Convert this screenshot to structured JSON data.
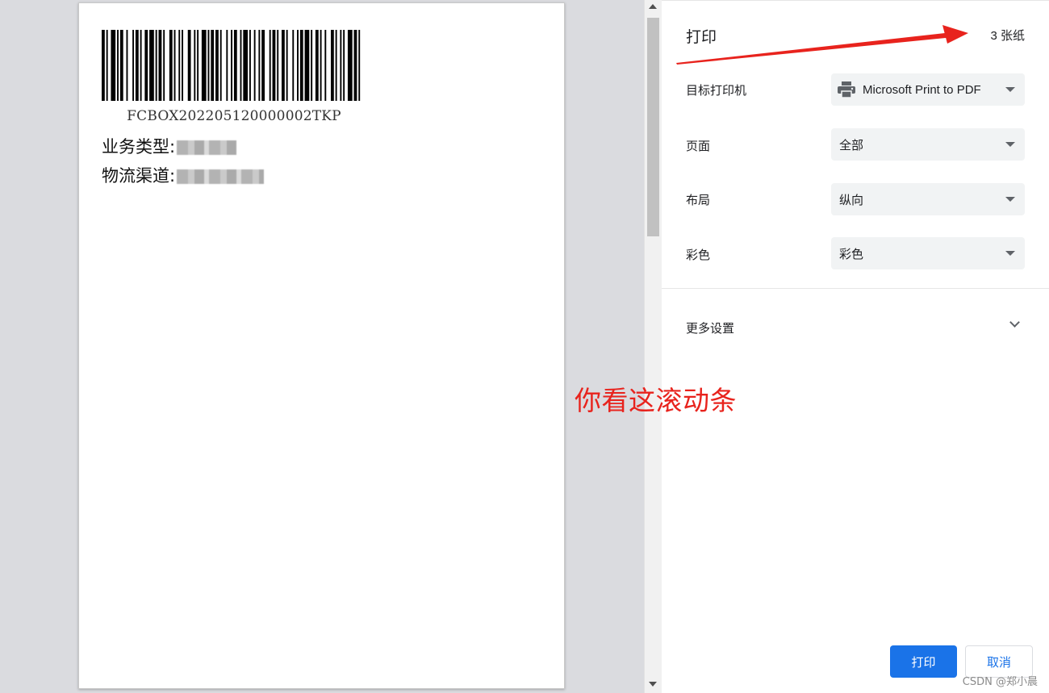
{
  "preview": {
    "barcode_text": "FCBOX202205120000002TKP",
    "fields": [
      {
        "label": "业务类型:"
      },
      {
        "label": "物流渠道:"
      }
    ]
  },
  "panel": {
    "title": "打印",
    "sheet_count": "3 张纸",
    "settings": {
      "printer": {
        "label": "目标打印机",
        "value": "Microsoft Print to PDF"
      },
      "pages": {
        "label": "页面",
        "value": "全部"
      },
      "layout": {
        "label": "布局",
        "value": "纵向"
      },
      "color": {
        "label": "彩色",
        "value": "彩色"
      }
    },
    "more_settings": "更多设置",
    "print_button": "打印",
    "cancel_button": "取消"
  },
  "annotation": {
    "text": "你看这滚动条",
    "color": "#e8231d"
  },
  "watermark": "CSDN @郑小晨",
  "colors": {
    "primary": "#1a73e8",
    "select_bg": "#f1f3f4",
    "preview_bg": "#dadbdf"
  },
  "icons": {
    "printer": "printer-icon",
    "dropdown": "chevron-down-icon",
    "expand": "chevron-down-icon"
  }
}
